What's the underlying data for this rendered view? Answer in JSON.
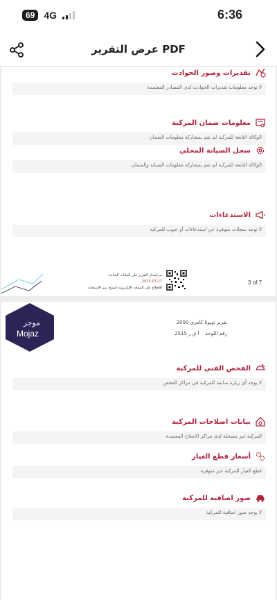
{
  "status": {
    "battery": "69",
    "network": "4G",
    "time": "6:36"
  },
  "nav": {
    "title": "عرض التقرير PDF"
  },
  "page1": {
    "sections": [
      {
        "title": "تقديرات وصور الحوادث",
        "text": "لا توجد معلومات تقديرات الحوادث لدى المصادر المعتمدة",
        "icon": "accident-icon"
      },
      {
        "title": "معلومات ضمان المركبة",
        "text": "الوكالة التابعة للمركبة لم تقم بمشاركة معلومات الضمان",
        "icon": "warranty-icon"
      },
      {
        "title": "سجل الصيانة المحلي",
        "text": "الوكالة التابعة للمركبة لم تقم بمشاركة معلومات الصيانة والضمان",
        "icon": "gear-icon"
      },
      {
        "title": "الاستدعاءات",
        "text": "لا توجد سجلات متوفرة عن استدعاءات أو عيوب للمركبة",
        "icon": "megaphone-icon"
      }
    ],
    "footer": {
      "page_num": "3 of 7",
      "issued": "تم إصدار التقرير على البيانات المتاحة",
      "date": "2025-07-27",
      "verify": "للاطلاع على النسخة الإلكترونية امسح رمز الاستجابة"
    }
  },
  "page2": {
    "logo_ar": "موجز",
    "logo_en": "Mojaz",
    "vehicle_title": "تقرير تويوتا كامري 2000",
    "plate_label": "رقم اللوحة",
    "plate_value": "آ ق ر 2515",
    "sections": [
      {
        "title": "الفحص الفني للمركبة",
        "text": "لا يوجد أي زيارة سابقة للمركبة في مراكز الفحص",
        "icon": "inspection-icon"
      },
      {
        "title": "بيانات اصلاحات المركبة",
        "text": "المركبة غير مسجلة لدى مراكز الاصلاح المعتمدة",
        "icon": "repair-icon"
      },
      {
        "title": "أسعار قطع الغيار",
        "text": "قطع الغيار للمركبة غير متوفرة",
        "icon": "parts-icon"
      },
      {
        "title": "صور اضافية للمركبة",
        "text": "لا يوجد صور اضافية للمركبة",
        "icon": "car-icon"
      }
    ]
  },
  "colors": {
    "accent": "#b0243a",
    "logo_bg": "#2b2456"
  }
}
